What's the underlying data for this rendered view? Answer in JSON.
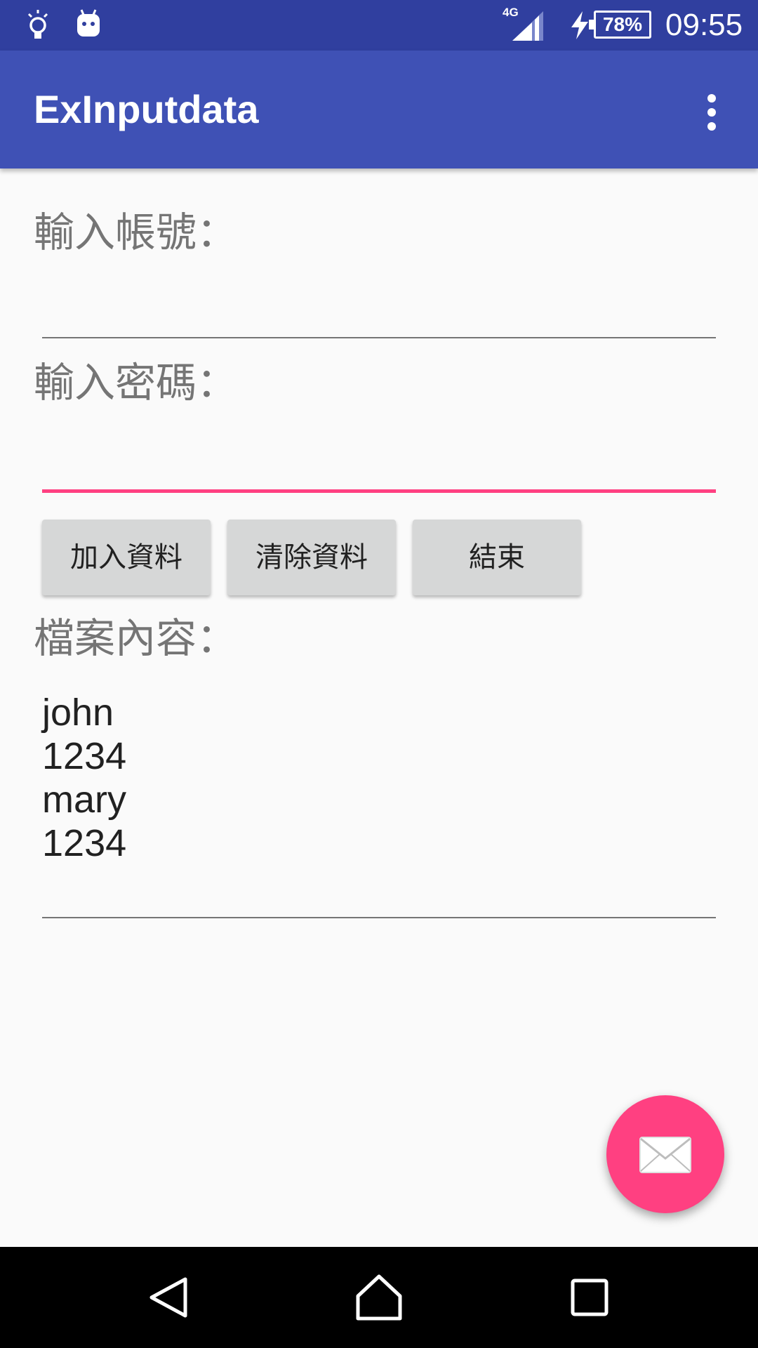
{
  "status_bar": {
    "network": "4G",
    "battery": "78%",
    "time": "09:55"
  },
  "app_bar": {
    "title": "ExInputdata"
  },
  "form": {
    "account_label": "輸入帳號：",
    "account_value": "",
    "password_label": "輸入密碼：",
    "password_value": ""
  },
  "buttons": {
    "add": "加入資料",
    "clear": "清除資料",
    "exit": "結束"
  },
  "file": {
    "label": "檔案內容：",
    "lines": [
      "john",
      "1234",
      "mary",
      "1234"
    ]
  },
  "colors": {
    "status_bar": "#303f9f",
    "app_bar": "#3f51b5",
    "accent": "#ff4081",
    "button": "#d6d7d7"
  },
  "icons": {
    "fab": "mail-icon",
    "overflow": "more-vert-icon",
    "nav": [
      "back-icon",
      "home-icon",
      "recents-icon"
    ]
  }
}
